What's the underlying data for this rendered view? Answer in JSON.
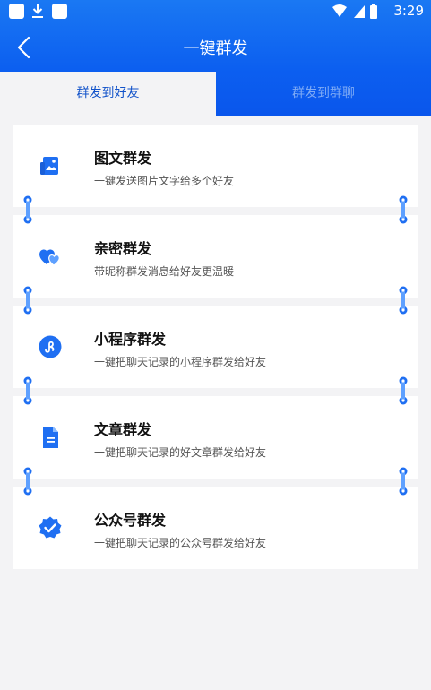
{
  "status_bar": {
    "time": "3:29"
  },
  "header": {
    "title": "一键群发",
    "back_icon": "back-arrow-icon"
  },
  "tabs": [
    {
      "label": "群发到好友",
      "active": true
    },
    {
      "label": "群发到群聊",
      "active": false
    }
  ],
  "features": [
    {
      "title": "图文群发",
      "desc": "一键发送图片文字给多个好友",
      "icon": "image-text-icon"
    },
    {
      "title": "亲密群发",
      "desc": "带昵称群发消息给好友更温暖",
      "icon": "hearts-icon"
    },
    {
      "title": "小程序群发",
      "desc": "一键把聊天记录的小程序群发给好友",
      "icon": "mini-program-icon"
    },
    {
      "title": "文章群发",
      "desc": "一键把聊天记录的好文章群发给好友",
      "icon": "article-icon"
    },
    {
      "title": "公众号群发",
      "desc": "一键把聊天记录的公众号群发给好友",
      "icon": "official-account-icon"
    }
  ],
  "colors": {
    "primary": "#0c5ff0",
    "tab_active_text": "#1152c9",
    "tab_inactive_text": "#7eaaf5",
    "background": "#f3f3f5"
  }
}
